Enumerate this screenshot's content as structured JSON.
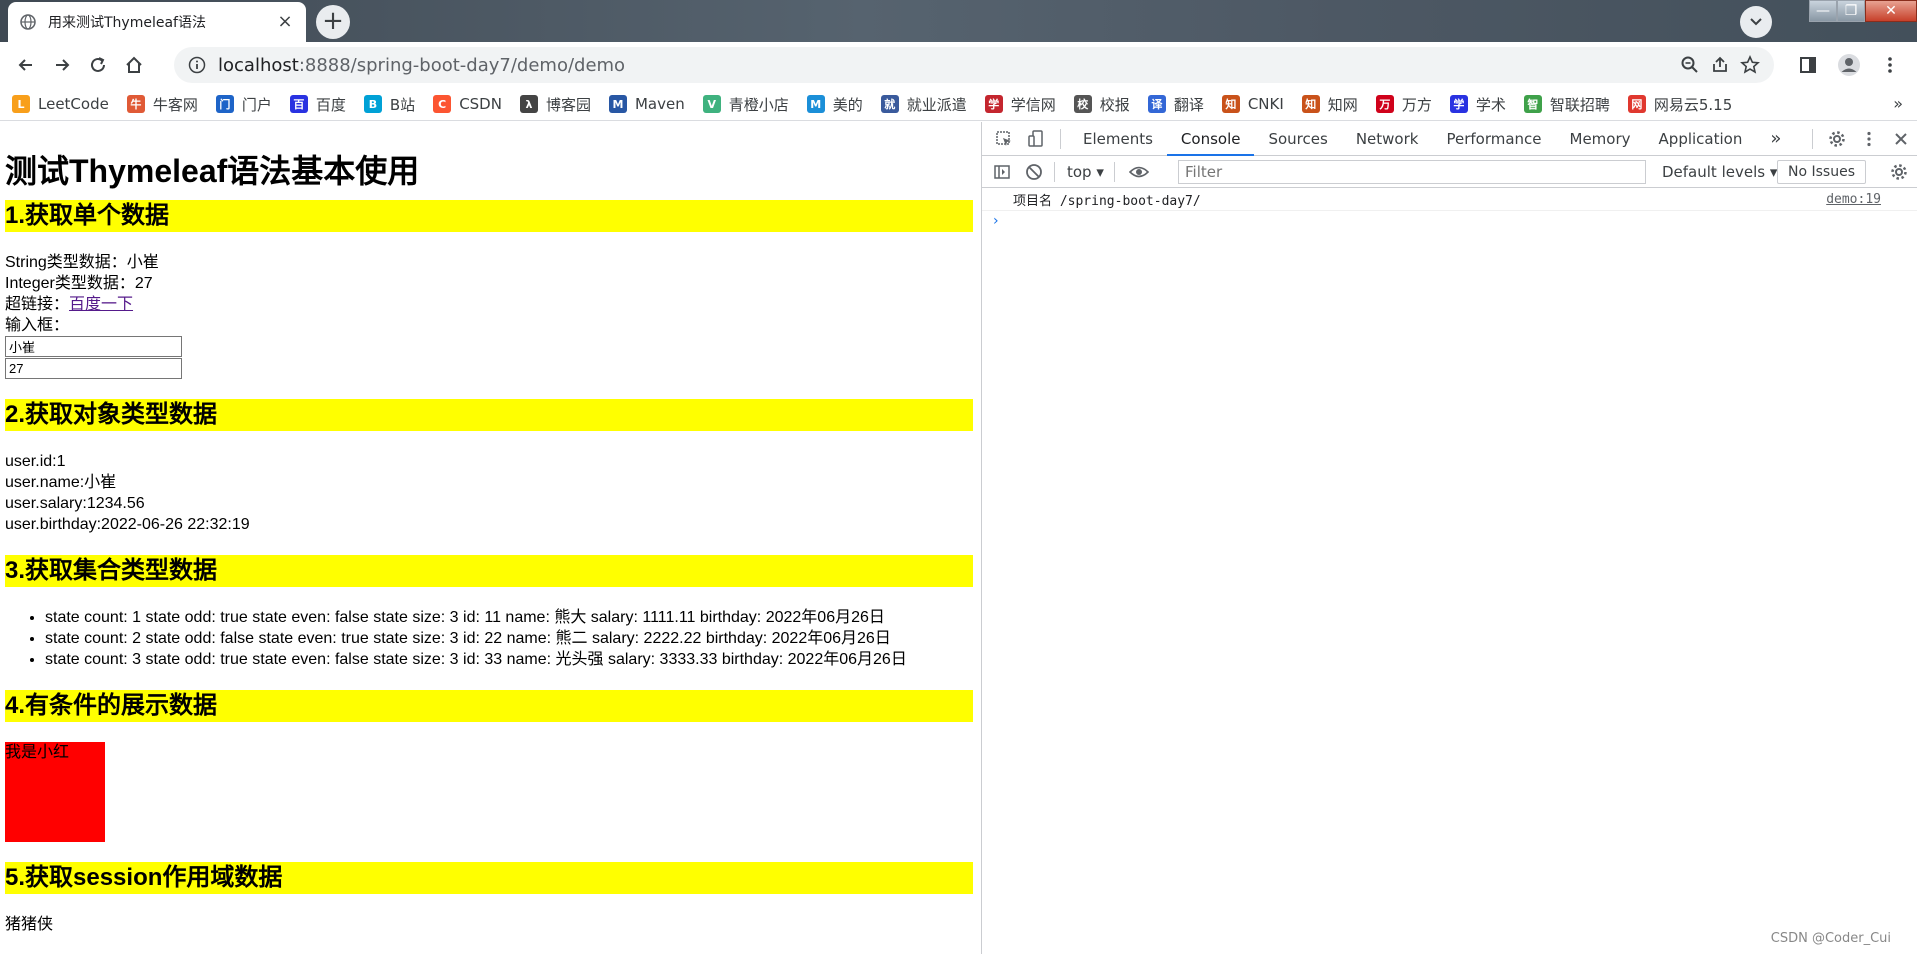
{
  "browser": {
    "tab_title": "用来测试Thymeleaf语法",
    "new_tab": "+",
    "url_host": "localhost",
    "url_rest": ":8888/spring-boot-day7/demo/demo"
  },
  "bookmarks": [
    {
      "label": "LeetCode",
      "icon": "leetcode-icon",
      "color": "#f89f1b",
      "glyph": "L"
    },
    {
      "label": "牛客网",
      "icon": "nowcoder-icon",
      "color": "#e05a36",
      "glyph": "牛"
    },
    {
      "label": "门户",
      "icon": "portal-icon",
      "color": "#1e64c8",
      "glyph": "门"
    },
    {
      "label": "百度",
      "icon": "baidu-paw-icon",
      "color": "#2932e1",
      "glyph": "百"
    },
    {
      "label": "B站",
      "icon": "bilibili-icon",
      "color": "#00a1d6",
      "glyph": "B"
    },
    {
      "label": "CSDN",
      "icon": "csdn-icon",
      "color": "#fc5531",
      "glyph": "C"
    },
    {
      "label": "博客园",
      "icon": "cnblogs-icon",
      "color": "#444444",
      "glyph": "λ"
    },
    {
      "label": "Maven",
      "icon": "maven-icon",
      "color": "#2857a4",
      "glyph": "M"
    },
    {
      "label": "青橙小店",
      "icon": "vue-icon",
      "color": "#3fb27f",
      "glyph": "V"
    },
    {
      "label": "美的",
      "icon": "midea-icon",
      "color": "#1b8fd8",
      "glyph": "M"
    },
    {
      "label": "就业派遣",
      "icon": "school-icon",
      "color": "#3a5a9c",
      "glyph": "就"
    },
    {
      "label": "学信网",
      "icon": "chsi-icon",
      "color": "#c4262e",
      "glyph": "学"
    },
    {
      "label": "校报",
      "icon": "globe-icon",
      "color": "#555555",
      "glyph": "校"
    },
    {
      "label": "翻译",
      "icon": "translate-icon",
      "color": "#3367d6",
      "glyph": "译"
    },
    {
      "label": "CNKI",
      "icon": "cnki-icon",
      "color": "#c9521a",
      "glyph": "知"
    },
    {
      "label": "知网",
      "icon": "cnki-icon",
      "color": "#c9521a",
      "glyph": "知"
    },
    {
      "label": "万方",
      "icon": "wanfang-icon",
      "color": "#d0021b",
      "glyph": "万"
    },
    {
      "label": "学术",
      "icon": "baidu-paw-icon",
      "color": "#2932e1",
      "glyph": "学"
    },
    {
      "label": "智联招聘",
      "icon": "zhaopin-icon",
      "color": "#3fa14a",
      "glyph": "智"
    },
    {
      "label": "网易云5.15",
      "icon": "netease-icon",
      "color": "#e0382f",
      "glyph": "网"
    }
  ],
  "page": {
    "h1": "测试Thymeleaf语法基本使用",
    "s1_title": "1.获取单个数据",
    "s1_string": "String类型数据：小崔",
    "s1_integer": "Integer类型数据：27",
    "s1_link_label": "超链接：",
    "s1_link_text": "百度一下",
    "s1_input_label": "输入框：",
    "s1_input1": "小崔",
    "s1_input2": "27",
    "s2_title": "2.获取对象类型数据",
    "s2_id": "user.id:1",
    "s2_name": "user.name:小崔",
    "s2_salary": "user.salary:1234.56",
    "s2_birthday": "user.birthday:2022-06-26 22:32:19",
    "s3_title": "3.获取集合类型数据",
    "s3_items": [
      "state count: 1 state odd: true state even: false state size: 3 id: 11 name: 熊大 salary: 1111.11 birthday: 2022年06月26日",
      "state count: 2 state odd: false state even: true state size: 3 id: 22 name: 熊二 salary: 2222.22 birthday: 2022年06月26日",
      "state count: 3 state odd: true state even: false state size: 3 id: 33 name: 光头强 salary: 3333.33 birthday: 2022年06月26日"
    ],
    "s4_title": "4.有条件的展示数据",
    "s4_box": "我是小红",
    "s5_title": "5.获取session作用域数据",
    "s5_value": "猪猪侠"
  },
  "devtools": {
    "tabs": [
      "Elements",
      "Console",
      "Sources",
      "Network",
      "Performance",
      "Memory",
      "Application"
    ],
    "active_tab": "Console",
    "more": "»",
    "context": "top ▾",
    "filter_placeholder": "Filter",
    "levels": "Default levels ▾",
    "issues": "No Issues",
    "log_text": "项目名 /spring-boot-day7/",
    "log_source": "demo:19",
    "prompt": "›"
  },
  "watermark": "CSDN @Coder_Cui",
  "colors": {
    "section_bg": "#ffff00",
    "red_box": "#ff0000",
    "link": "#551a8b",
    "devtools_accent": "#1a73e8"
  }
}
